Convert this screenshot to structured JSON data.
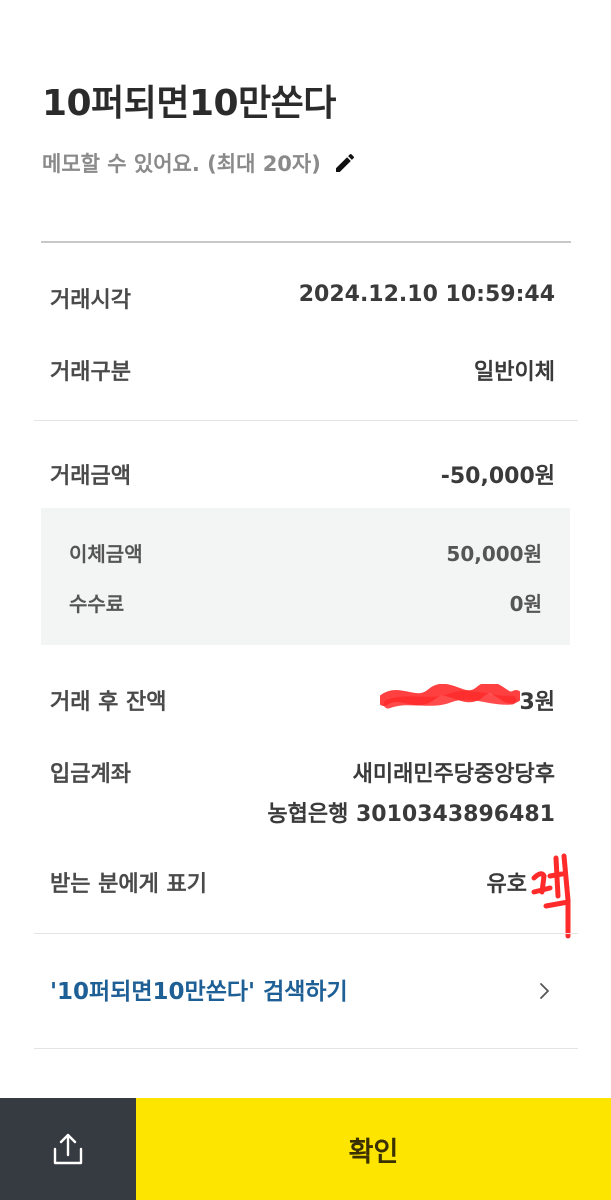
{
  "header": {
    "title": "10퍼되면10만쏜다",
    "memo_placeholder": "메모할 수 있어요. (최대 20자)",
    "edit_icon": "pencil-icon"
  },
  "details": {
    "time_label": "거래시각",
    "time_value": "2024.12.10 10:59:44",
    "type_label": "거래구분",
    "type_value": "일반이체",
    "amount_label": "거래금액",
    "amount_value": "-50,000원",
    "breakdown": {
      "transfer_label": "이체금액",
      "transfer_value": "50,000원",
      "fee_label": "수수료",
      "fee_value": "0원"
    },
    "balance_label": "거래 후 잔액",
    "balance_value_visible": "3원",
    "deposit_label": "입금계좌",
    "deposit_name": "새미래민주당중앙당후",
    "deposit_account": "농협은행 3010343896481",
    "display_label": "받는 분에게 표기",
    "display_value": "유호"
  },
  "search": {
    "label": "'10퍼되면10만쏜다' 검색하기",
    "icon": "chevron-right-icon"
  },
  "bottom": {
    "share_icon": "share-icon",
    "confirm_label": "확인"
  },
  "colors": {
    "confirm_bg": "#fee500",
    "share_bg": "#363b42",
    "link": "#1e5f95",
    "redaction": "#ff2b2b"
  }
}
